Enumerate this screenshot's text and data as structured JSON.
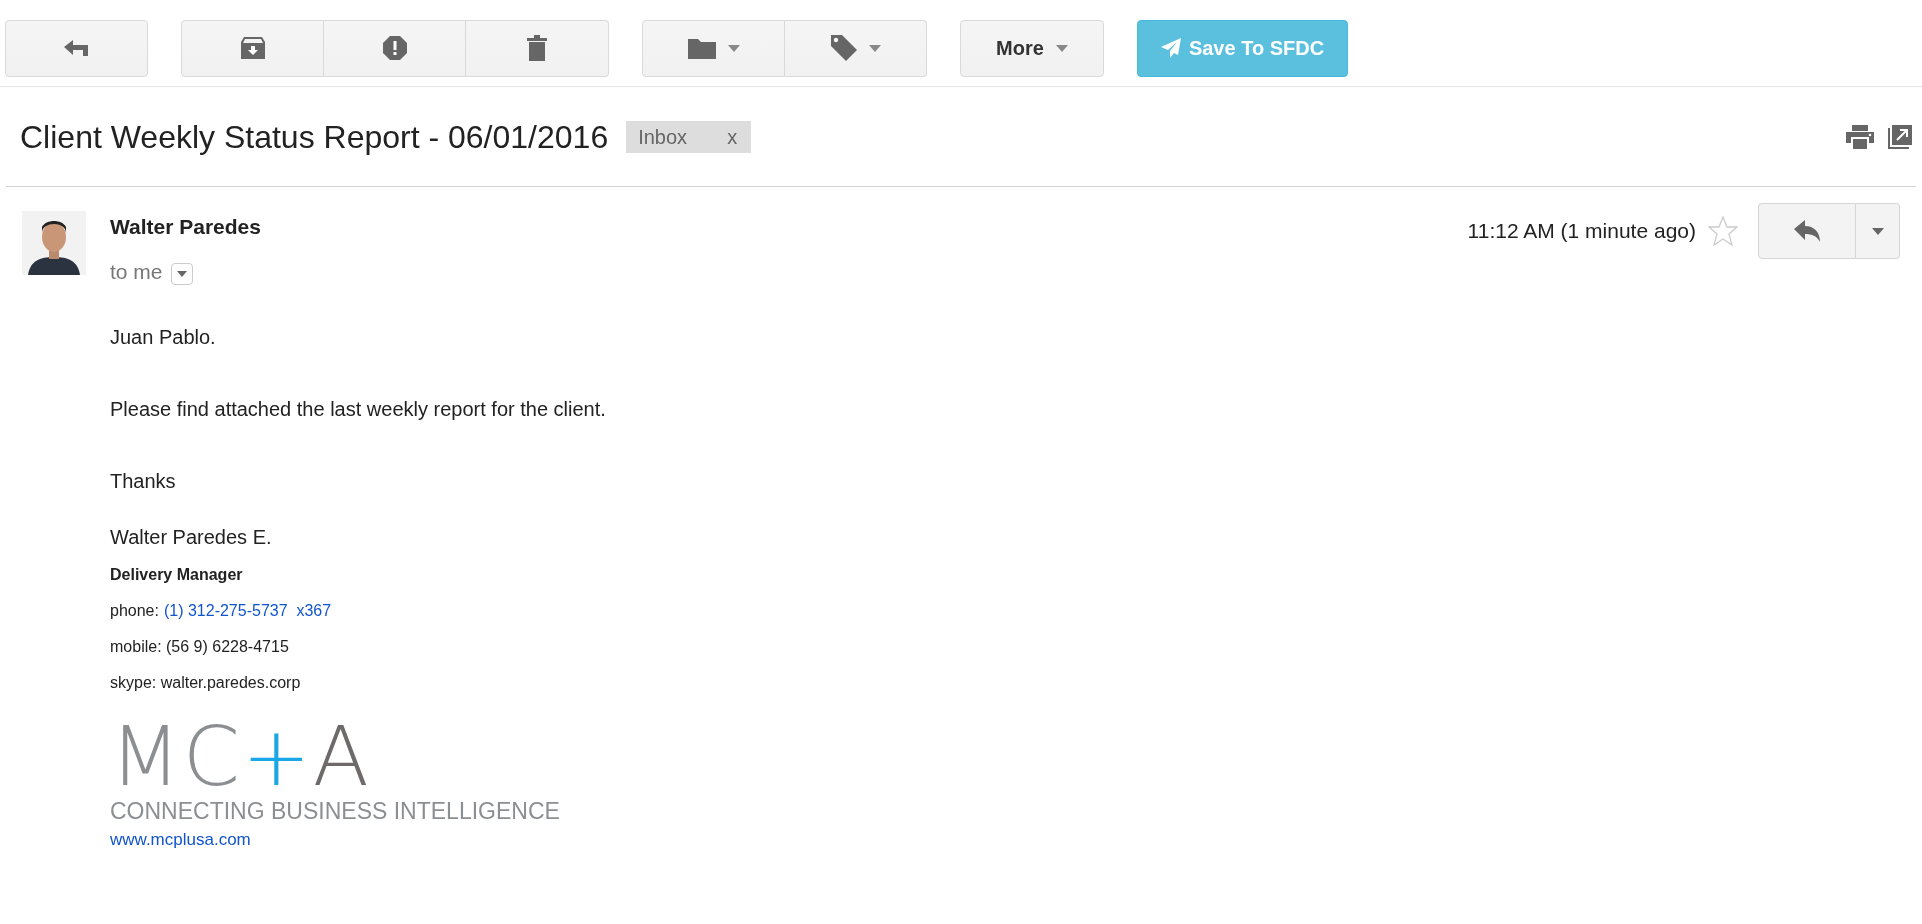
{
  "toolbar": {
    "more_label": "More",
    "save_label": "Save To SFDC"
  },
  "subject": {
    "title": "Client Weekly Status Report - 06/01/2016",
    "label": {
      "text": "Inbox",
      "remove": "x"
    }
  },
  "message": {
    "sender": "Walter Paredes",
    "recipient": "to me",
    "time": "11:12 AM (1 minute ago)",
    "starred": false
  },
  "body": [
    "Juan Pablo.",
    "Please find attached the last weekly report for the client.",
    "Thanks"
  ],
  "signature": {
    "name": "Walter Paredes E.",
    "role": "Delivery Manager",
    "phone_label": "phone:",
    "phone_link": "(1) 312-275-5737  x367",
    "mobile": "mobile: (56 9) 6228-4715",
    "skype": "skype: walter.paredes.corp",
    "logo_mark": [
      "MC",
      "+",
      "A"
    ],
    "logo_tagline": "CONNECTING BUSINESS INTELLIGENCE",
    "website": "www.mcplusa.com"
  }
}
